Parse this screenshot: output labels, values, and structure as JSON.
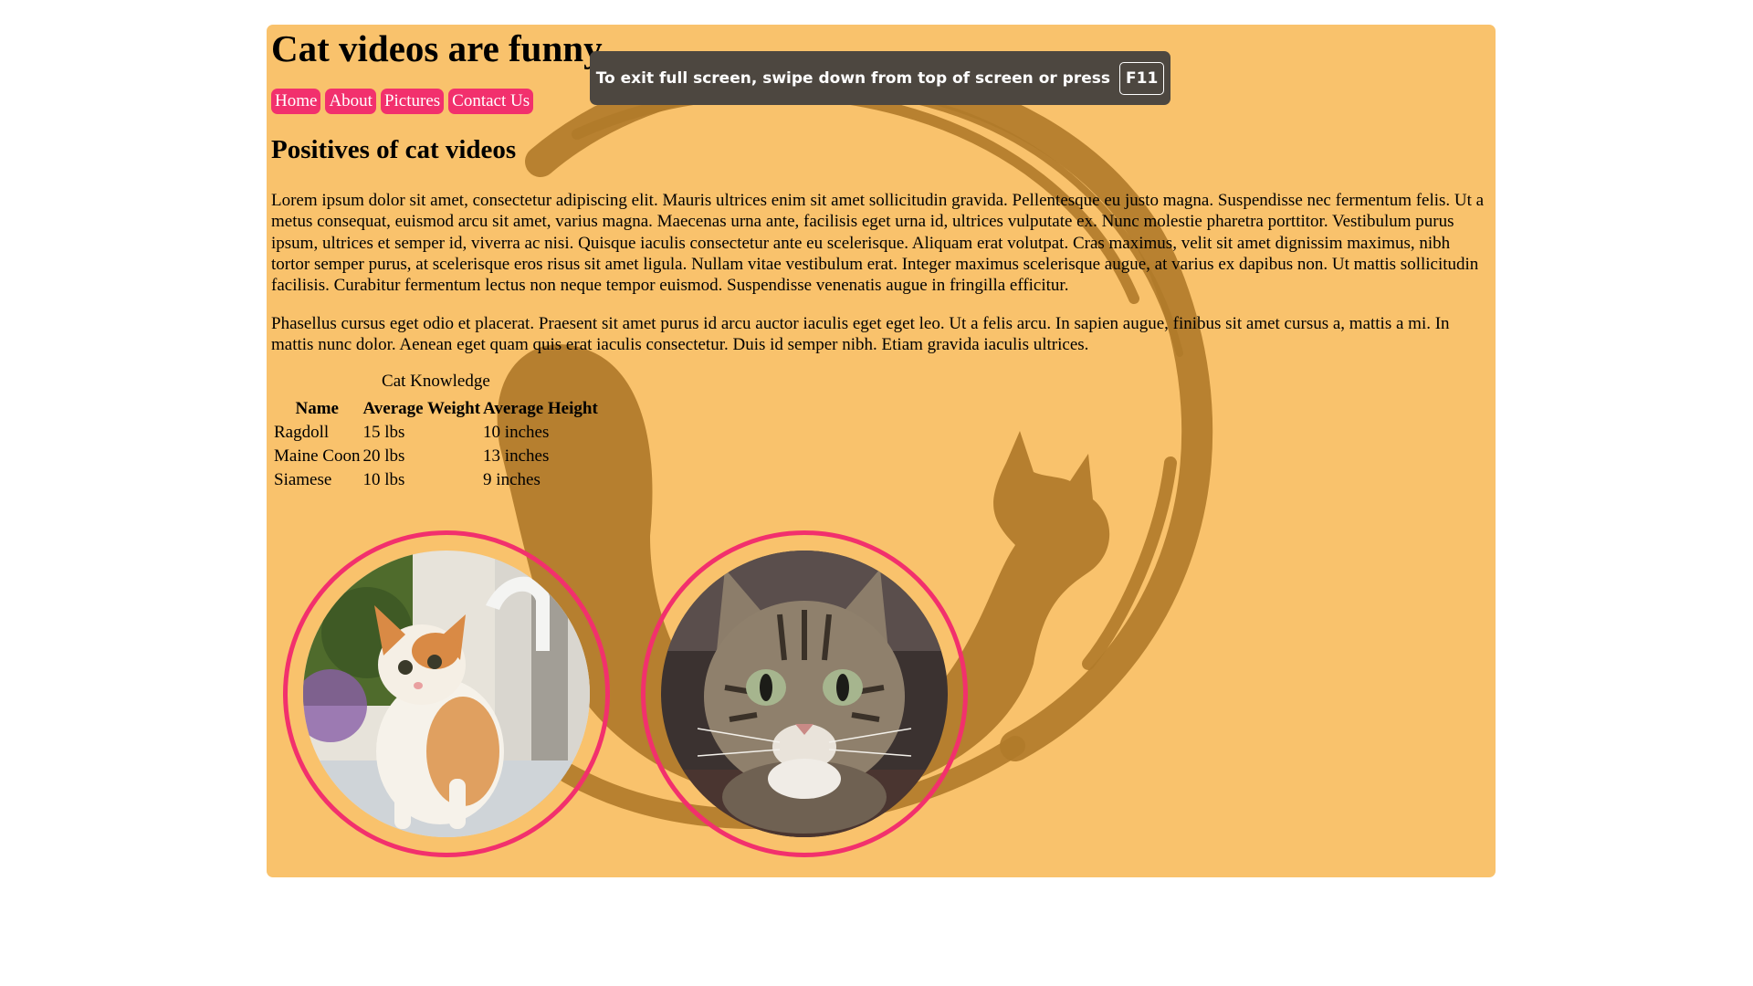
{
  "page": {
    "title": "Cat videos are funny",
    "nav": [
      "Home",
      "About",
      "Pictures",
      "Contact Us"
    ],
    "subtitle": "Positives of cat videos",
    "paragraphs": [
      "Lorem ipsum dolor sit amet, consectetur adipiscing elit. Mauris ultrices enim sit amet sollicitudin gravida. Pellentesque eu justo magna. Suspendisse nec fermentum felis. Ut a metus consequat, euismod arcu sit amet, varius magna. Maecenas urna ante, facilisis eget urna id, ultrices vulputate ex. Nunc molestie pharetra porttitor. Vestibulum purus ipsum, ultrices et semper id, viverra ac nisi. Quisque iaculis consectetur ante eu scelerisque. Aliquam erat volutpat. Cras maximus, velit sit amet dignissim maximus, nibh tortor semper purus, at scelerisque eros risus sit amet ligula. Nullam vitae vestibulum erat. Integer maximus scelerisque augue, at varius ex dapibus non. Ut mattis sollicitudin facilisis. Curabitur fermentum lectus non neque tempor euismod. Suspendisse venenatis augue in fringilla efficitur.",
      "Phasellus cursus eget odio et placerat. Praesent sit amet purus id arcu auctor iaculis eget eget leo. Ut a felis arcu. In sapien augue, finibus sit amet cursus a, mattis a mi. In mattis nunc dolor. Aenean eget quam quis erat iaculis consectetur. Duis id semper nibh. Etiam gravida iaculis ultrices."
    ],
    "table": {
      "caption": "Cat Knowledge",
      "headers": [
        "Name",
        "Average Weight",
        "Average Height"
      ],
      "rows": [
        [
          "Ragdoll",
          "15 lbs",
          "10 inches"
        ],
        [
          "Maine Coon",
          "20 lbs",
          "13 inches"
        ],
        [
          "Siamese",
          "10 lbs",
          "9 inches"
        ]
      ]
    }
  },
  "fullscreen_toast": {
    "message": "To exit full screen, swipe down from top of screen or press",
    "key": "F11"
  },
  "colors": {
    "page_bg": "#f9c26c",
    "accent_pink": "#f2306d",
    "toast_bg": "#4d4740",
    "watermark": "#b07a2a"
  },
  "icons": {
    "background": "cat-silhouette-watermark",
    "photo_1": "orange-white-kitten-photo",
    "photo_2": "tabby-cat-photo"
  }
}
